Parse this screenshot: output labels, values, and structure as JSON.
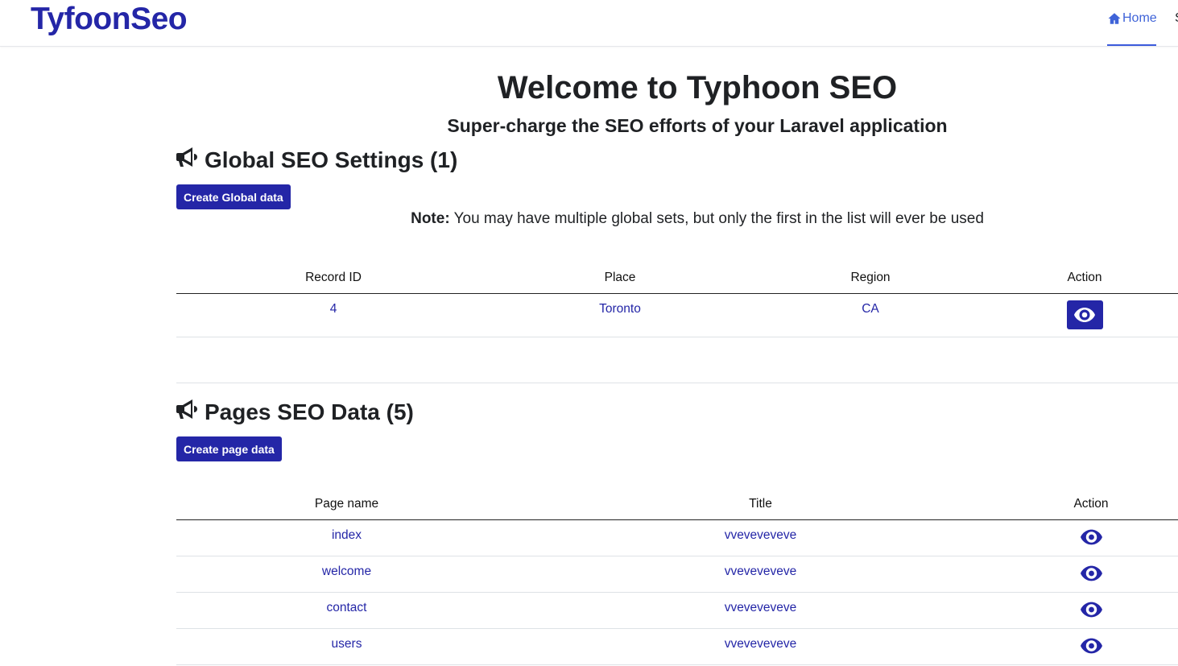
{
  "navbar": {
    "brand": "TyfoonSeo",
    "home_label": "Home",
    "cut_label": "S"
  },
  "hero": {
    "title": "Welcome to Typhoon SEO",
    "subtitle": "Super-charge the SEO efforts of your Laravel application"
  },
  "global_section": {
    "heading": "Global SEO Settings (1)",
    "create_button": "Create Global data",
    "note_bold": "Note:",
    "note_text": " You may have multiple global sets, but only the first in the list will ever be used",
    "columns": [
      "Record ID",
      "Place",
      "Region",
      "Action"
    ],
    "rows": [
      {
        "record_id": "4",
        "place": "Toronto",
        "region": "CA"
      }
    ]
  },
  "pages_section": {
    "heading": "Pages SEO Data (5)",
    "create_button": "Create page data",
    "columns": [
      "Page name",
      "Title",
      "Action"
    ],
    "rows": [
      {
        "page_name": "index",
        "title": "vveveveveve"
      },
      {
        "page_name": "welcome",
        "title": "vveveveveve"
      },
      {
        "page_name": "contact",
        "title": "vveveveveve"
      },
      {
        "page_name": "users",
        "title": "vveveveveve"
      }
    ]
  },
  "colors": {
    "brand": "#2426a7",
    "nav_active": "#3f63d8",
    "text": "#1f2124"
  },
  "icons": {
    "home": "home-icon",
    "section": "bullhorn-icon",
    "view": "eye-icon"
  }
}
